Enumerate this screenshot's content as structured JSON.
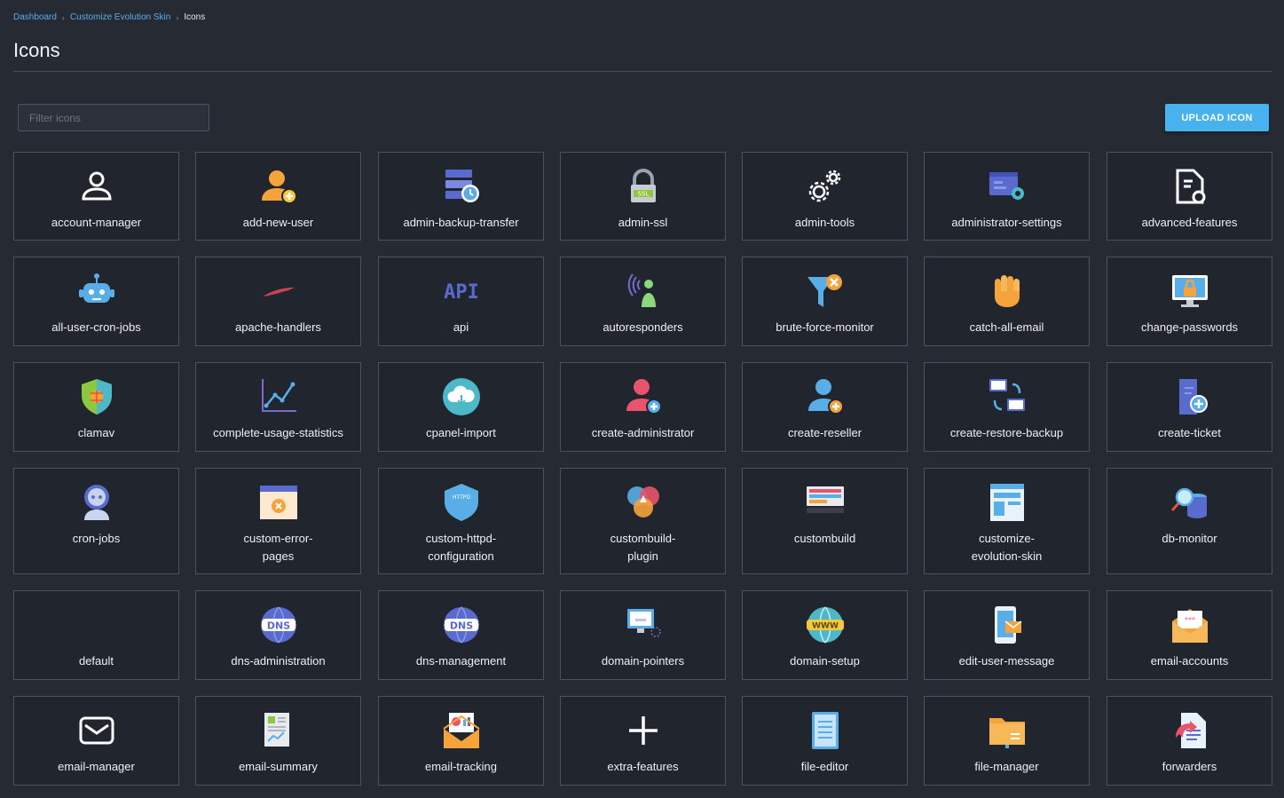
{
  "breadcrumb": {
    "items": [
      "Dashboard",
      "Customize Evolution Skin"
    ],
    "current": "Icons"
  },
  "page": {
    "title": "Icons"
  },
  "filter": {
    "placeholder": "Filter icons",
    "value": ""
  },
  "toolbar": {
    "upload_label": "UPLOAD ICON"
  },
  "colors": {
    "background": "#262a33",
    "card": "#21252d",
    "accent": "#47b2ee",
    "link": "#5aaee8"
  },
  "icons": [
    {
      "label": "account-manager",
      "icon": "user-outline-icon"
    },
    {
      "label": "add-new-user",
      "icon": "user-add-icon"
    },
    {
      "label": "admin-backup-transfer",
      "icon": "server-clock-icon"
    },
    {
      "label": "admin-ssl",
      "icon": "ssl-lock-icon"
    },
    {
      "label": "admin-tools",
      "icon": "gears-icon"
    },
    {
      "label": "administrator-settings",
      "icon": "window-gear-icon"
    },
    {
      "label": "advanced-features",
      "icon": "document-gear-icon"
    },
    {
      "label": "all-user-cron-jobs",
      "icon": "robot-icon"
    },
    {
      "label": "apache-handlers",
      "icon": "feather-icon"
    },
    {
      "label": "api",
      "icon": "api-text-icon"
    },
    {
      "label": "autoresponders",
      "icon": "person-signal-icon"
    },
    {
      "label": "brute-force-monitor",
      "icon": "funnel-x-icon"
    },
    {
      "label": "catch-all-email",
      "icon": "hand-icon"
    },
    {
      "label": "change-passwords",
      "icon": "monitor-lock-icon"
    },
    {
      "label": "clamav",
      "icon": "shield-bug-icon"
    },
    {
      "label": "complete-usage-statistics",
      "icon": "line-chart-icon"
    },
    {
      "label": "cpanel-import",
      "icon": "cloud-icon"
    },
    {
      "label": "create-administrator",
      "icon": "user-add-red-icon"
    },
    {
      "label": "create-reseller",
      "icon": "user-add-blue-icon"
    },
    {
      "label": "create-restore-backup",
      "icon": "monitor-sync-icon"
    },
    {
      "label": "create-ticket",
      "icon": "ticket-add-icon"
    },
    {
      "label": "cron-jobs",
      "icon": "astronaut-icon"
    },
    {
      "label": "custom-error-pages",
      "icon": "browser-error-icon"
    },
    {
      "label": "custom-httpd-configuration",
      "icon": "httpd-shield-icon"
    },
    {
      "label": "custombuild-plugin",
      "icon": "color-circles-icon"
    },
    {
      "label": "custombuild",
      "icon": "server-stack-icon"
    },
    {
      "label": "customize-evolution-skin",
      "icon": "layout-icon"
    },
    {
      "label": "db-monitor",
      "icon": "database-search-icon"
    },
    {
      "label": "default",
      "icon": ""
    },
    {
      "label": "dns-administration",
      "icon": "dns-globe-icon"
    },
    {
      "label": "dns-management",
      "icon": "dns-globe-icon"
    },
    {
      "label": "domain-pointers",
      "icon": "monitor-pointer-icon"
    },
    {
      "label": "domain-setup",
      "icon": "www-globe-icon"
    },
    {
      "label": "edit-user-message",
      "icon": "phone-mail-icon"
    },
    {
      "label": "email-accounts",
      "icon": "envelope-letter-icon"
    },
    {
      "label": "email-manager",
      "icon": "envelope-outline-icon"
    },
    {
      "label": "email-summary",
      "icon": "report-icon"
    },
    {
      "label": "email-tracking",
      "icon": "envelope-chart-icon"
    },
    {
      "label": "extra-features",
      "icon": "plus-icon"
    },
    {
      "label": "file-editor",
      "icon": "file-lines-icon"
    },
    {
      "label": "file-manager",
      "icon": "folder-icon"
    },
    {
      "label": "forwarders",
      "icon": "forward-doc-icon"
    }
  ]
}
